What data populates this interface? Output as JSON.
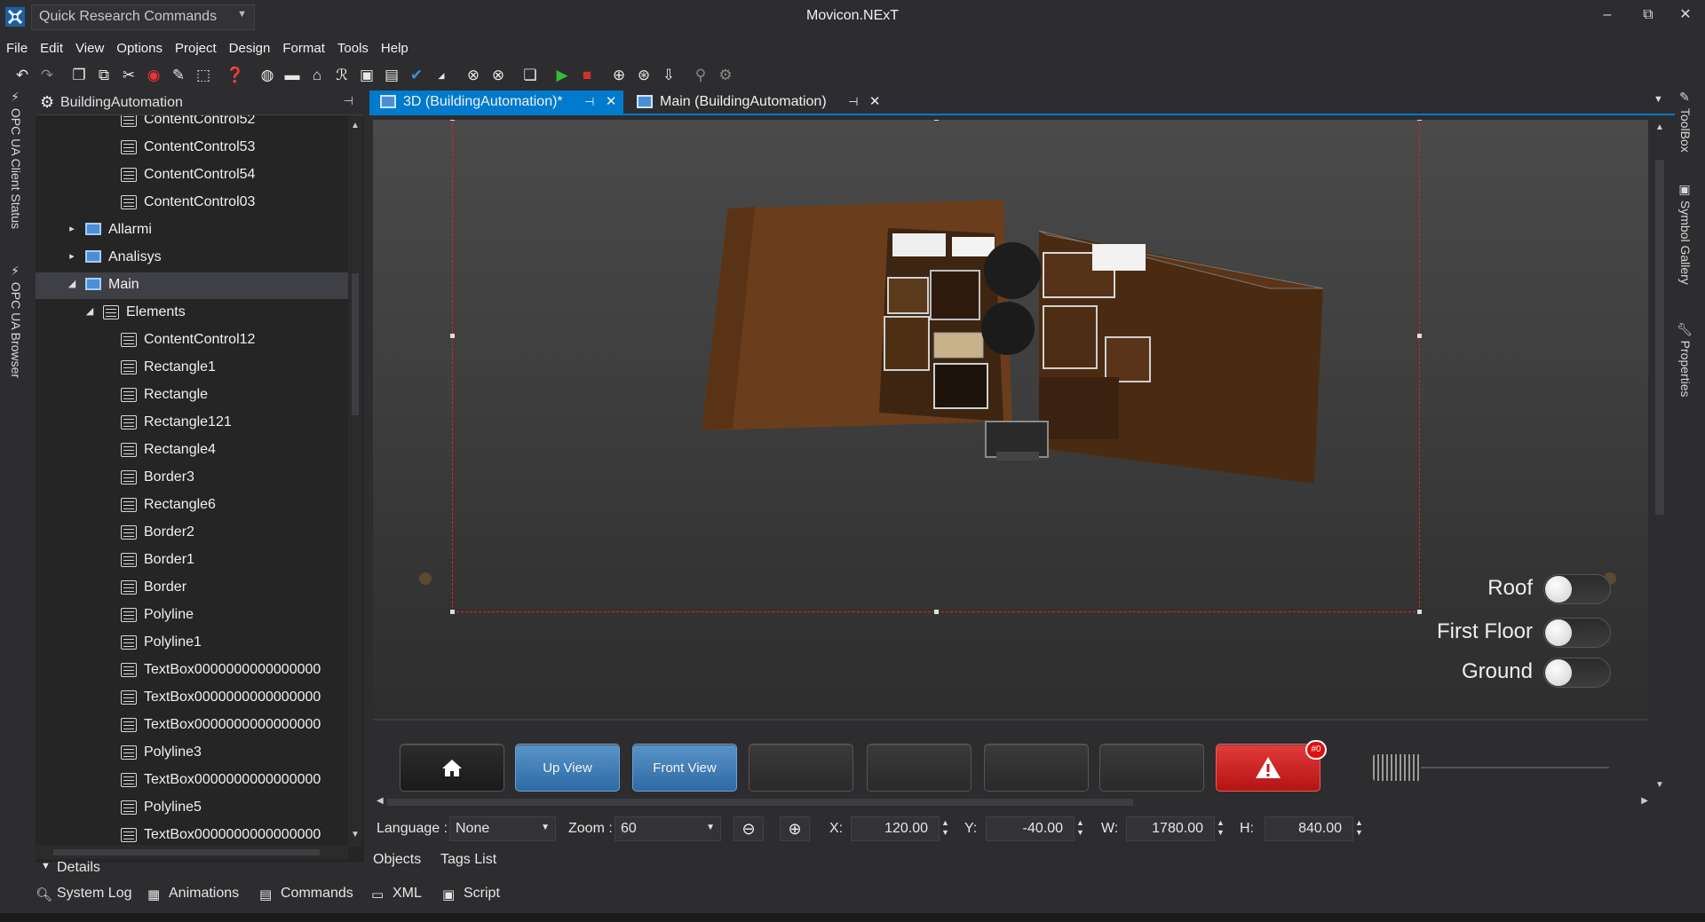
{
  "titlebar": {
    "quick_search": "Quick Research Commands",
    "app_title": "Movicon.NExT",
    "minimize": "–",
    "restore": "⧉",
    "close": "✕"
  },
  "menu": [
    "File",
    "Edit",
    "View",
    "Options",
    "Project",
    "Design",
    "Format",
    "Tools",
    "Help"
  ],
  "left_dock": {
    "tab1": "OPC UA Client Status",
    "tab2": "OPC UA Browser"
  },
  "right_dock": {
    "tab1": "ToolBox",
    "tab2": "Symbol Gallery",
    "tab3": "Properties"
  },
  "explorer": {
    "title": "BuildingAutomation",
    "pin": "⊣",
    "items": [
      {
        "label": "ContentControl52",
        "level": 3,
        "type": "doc"
      },
      {
        "label": "ContentControl53",
        "level": 3,
        "type": "doc"
      },
      {
        "label": "ContentControl54",
        "level": 3,
        "type": "doc"
      },
      {
        "label": "ContentControl03",
        "level": 3,
        "type": "doc"
      },
      {
        "label": "Allarmi",
        "level": 1,
        "type": "screen",
        "arrow": "▸"
      },
      {
        "label": "Analisys",
        "level": 1,
        "type": "screen",
        "arrow": "▸"
      },
      {
        "label": "Main",
        "level": 1,
        "type": "screen",
        "arrow": "◢",
        "selected": true
      },
      {
        "label": "Elements",
        "level": 2,
        "type": "doc",
        "arrow": "◢"
      },
      {
        "label": "ContentControl12",
        "level": 3,
        "type": "doc"
      },
      {
        "label": "Rectangle1",
        "level": 3,
        "type": "doc"
      },
      {
        "label": "Rectangle",
        "level": 3,
        "type": "doc"
      },
      {
        "label": "Rectangle121",
        "level": 3,
        "type": "doc"
      },
      {
        "label": "Rectangle4",
        "level": 3,
        "type": "doc"
      },
      {
        "label": "Border3",
        "level": 3,
        "type": "doc"
      },
      {
        "label": "Rectangle6",
        "level": 3,
        "type": "doc"
      },
      {
        "label": "Border2",
        "level": 3,
        "type": "doc"
      },
      {
        "label": "Border1",
        "level": 3,
        "type": "doc"
      },
      {
        "label": "Border",
        "level": 3,
        "type": "doc"
      },
      {
        "label": "Polyline",
        "level": 3,
        "type": "doc"
      },
      {
        "label": "Polyline1",
        "level": 3,
        "type": "doc"
      },
      {
        "label": "TextBox0000000000000000",
        "level": 3,
        "type": "doc"
      },
      {
        "label": "TextBox0000000000000000",
        "level": 3,
        "type": "doc"
      },
      {
        "label": "TextBox0000000000000000",
        "level": 3,
        "type": "doc"
      },
      {
        "label": "Polyline3",
        "level": 3,
        "type": "doc"
      },
      {
        "label": "TextBox0000000000000000",
        "level": 3,
        "type": "doc"
      },
      {
        "label": "Polyline5",
        "level": 3,
        "type": "doc"
      },
      {
        "label": "TextBox0000000000000000",
        "level": 3,
        "type": "doc"
      }
    ],
    "details_label": "Details"
  },
  "doc_tabs": [
    {
      "label": "3D (BuildingAutomation)*",
      "active": true
    },
    {
      "label": "Main (BuildingAutomation)",
      "active": false
    }
  ],
  "canvas": {
    "toggles": [
      {
        "label": "Roof",
        "on": false
      },
      {
        "label": "First Floor",
        "on": false
      },
      {
        "label": "Ground",
        "on": false
      }
    ],
    "buttons": {
      "home": "home-icon",
      "up_view": "Up View",
      "front_view": "Front View",
      "alarm": "warning-icon",
      "alarm_badge": "#0"
    }
  },
  "props": {
    "language_label": "Language :",
    "language_value": "None",
    "zoom_label": "Zoom :",
    "zoom_value": "60",
    "x_label": "X:",
    "x_value": "120.00",
    "y_label": "Y:",
    "y_value": "-40.00",
    "w_label": "W:",
    "w_value": "1780.00",
    "h_label": "H:",
    "h_value": "840.00"
  },
  "obj_tabs": [
    "Objects",
    "Tags List"
  ],
  "bottom_tabs": [
    "System Log",
    "Animations",
    "Commands",
    "XML",
    "Script"
  ],
  "colors": {
    "accent": "#007acc",
    "selection": "#e02020",
    "alarm": "#d42020",
    "view_button": "#3a78b4"
  }
}
